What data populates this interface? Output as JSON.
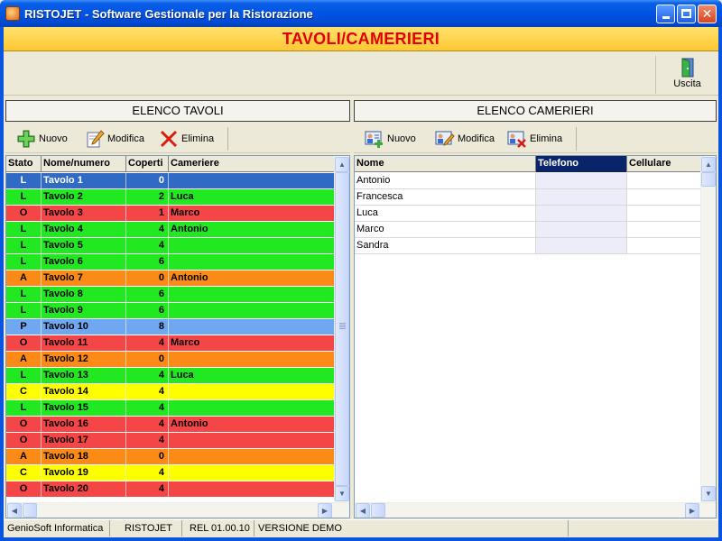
{
  "window": {
    "title": "RISTOJET - Software Gestionale per la Ristorazione"
  },
  "header": {
    "title": "TAVOLI/CAMERIERI"
  },
  "toolbar": {
    "exit_label": "Uscita"
  },
  "tables_panel": {
    "title": "ELENCO TAVOLI",
    "buttons": {
      "new": "Nuovo",
      "edit": "Modifica",
      "delete": "Elimina"
    },
    "columns": [
      "Stato",
      "Nome/numero",
      "Coperti",
      "Cameriere"
    ],
    "rows": [
      {
        "stato": "L",
        "nome": "Tavolo 1",
        "coperti": "0",
        "cameriere": "",
        "color": "#316ac5",
        "selected": true
      },
      {
        "stato": "L",
        "nome": "Tavolo 2",
        "coperti": "2",
        "cameriere": "Luca",
        "color": "#22e822"
      },
      {
        "stato": "O",
        "nome": "Tavolo 3",
        "coperti": "1",
        "cameriere": "Marco",
        "color": "#f44646"
      },
      {
        "stato": "L",
        "nome": "Tavolo 4",
        "coperti": "4",
        "cameriere": "Antonio",
        "color": "#22e822"
      },
      {
        "stato": "L",
        "nome": "Tavolo 5",
        "coperti": "4",
        "cameriere": "",
        "color": "#22e822"
      },
      {
        "stato": "L",
        "nome": "Tavolo 6",
        "coperti": "6",
        "cameriere": "",
        "color": "#22e822"
      },
      {
        "stato": "A",
        "nome": "Tavolo 7",
        "coperti": "0",
        "cameriere": "Antonio",
        "color": "#fb8b16"
      },
      {
        "stato": "L",
        "nome": "Tavolo 8",
        "coperti": "6",
        "cameriere": "",
        "color": "#22e822"
      },
      {
        "stato": "L",
        "nome": "Tavolo 9",
        "coperti": "6",
        "cameriere": "",
        "color": "#22e822"
      },
      {
        "stato": "P",
        "nome": "Tavolo 10",
        "coperti": "8",
        "cameriere": "",
        "color": "#6fa8f0"
      },
      {
        "stato": "O",
        "nome": "Tavolo 11",
        "coperti": "4",
        "cameriere": "Marco",
        "color": "#f44646"
      },
      {
        "stato": "A",
        "nome": "Tavolo 12",
        "coperti": "0",
        "cameriere": "",
        "color": "#fb8b16"
      },
      {
        "stato": "L",
        "nome": "Tavolo 13",
        "coperti": "4",
        "cameriere": "Luca",
        "color": "#22e822"
      },
      {
        "stato": "C",
        "nome": "Tavolo 14",
        "coperti": "4",
        "cameriere": "",
        "color": "#ffff00"
      },
      {
        "stato": "L",
        "nome": "Tavolo 15",
        "coperti": "4",
        "cameriere": "",
        "color": "#22e822"
      },
      {
        "stato": "O",
        "nome": "Tavolo 16",
        "coperti": "4",
        "cameriere": "Antonio",
        "color": "#f44646"
      },
      {
        "stato": "O",
        "nome": "Tavolo 17",
        "coperti": "4",
        "cameriere": "",
        "color": "#f44646"
      },
      {
        "stato": "A",
        "nome": "Tavolo 18",
        "coperti": "0",
        "cameriere": "",
        "color": "#fb8b16"
      },
      {
        "stato": "C",
        "nome": "Tavolo 19",
        "coperti": "4",
        "cameriere": "",
        "color": "#ffff00"
      },
      {
        "stato": "O",
        "nome": "Tavolo 20",
        "coperti": "4",
        "cameriere": "",
        "color": "#f44646"
      }
    ]
  },
  "waiters_panel": {
    "title": "ELENCO CAMERIERI",
    "buttons": {
      "new": "Nuovo",
      "edit": "Modifica",
      "delete": "Elimina"
    },
    "columns": [
      "Nome",
      "Telefono",
      "Cellulare"
    ],
    "rows": [
      {
        "nome": "Antonio",
        "telefono": "",
        "cellulare": ""
      },
      {
        "nome": "Francesca",
        "telefono": "",
        "cellulare": ""
      },
      {
        "nome": "Luca",
        "telefono": "",
        "cellulare": ""
      },
      {
        "nome": "Marco",
        "telefono": "",
        "cellulare": ""
      },
      {
        "nome": "Sandra",
        "telefono": "",
        "cellulare": ""
      }
    ]
  },
  "statusbar": {
    "company": "GenioSoft Informatica",
    "app": "RISTOJET",
    "release": "REL 01.00.10",
    "version": "VERSIONE DEMO"
  },
  "colors": {
    "title_bar": "#0054e3",
    "header_bg": "#ffc832",
    "header_text": "#e00000"
  }
}
